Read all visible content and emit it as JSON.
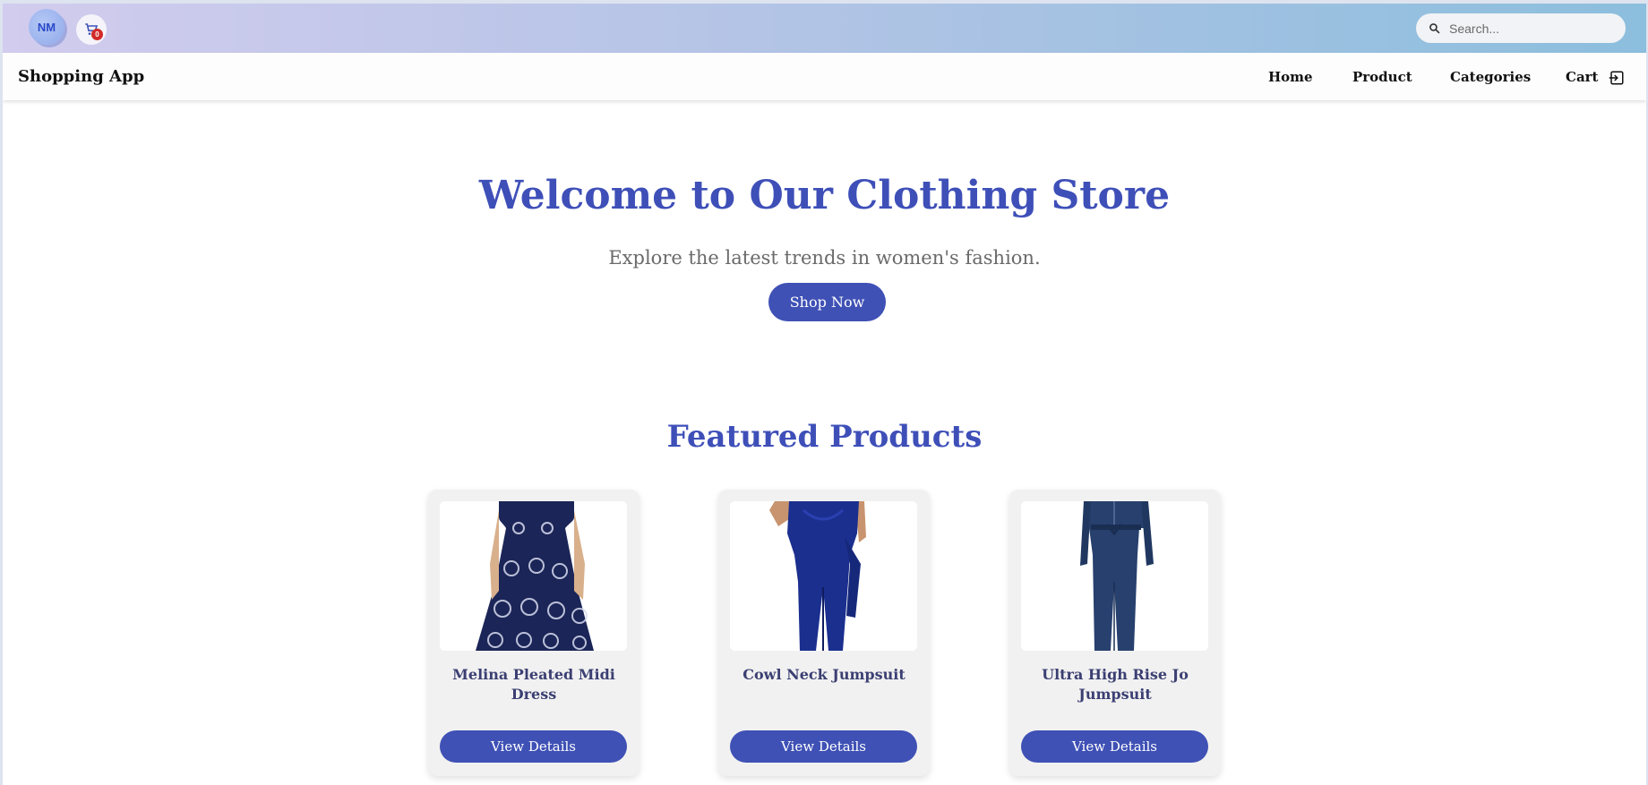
{
  "header": {
    "avatar_initials": "NM",
    "cart_count": "0",
    "search_placeholder": "Search..."
  },
  "nav": {
    "brand": "Shopping App",
    "links": [
      "Home",
      "Product",
      "Categories",
      "Cart"
    ]
  },
  "hero": {
    "title": "Welcome to Our Clothing Store",
    "subtitle": "Explore the latest trends in women's fashion.",
    "cta_label": "Shop Now"
  },
  "featured": {
    "title": "Featured Products",
    "products": [
      {
        "name": "Melina Pleated Midi Dress",
        "button_label": "View Details",
        "image_icon": "dress-image"
      },
      {
        "name": "Cowl Neck Jumpsuit",
        "button_label": "View Details",
        "image_icon": "jumpsuit-image"
      },
      {
        "name": "Ultra High Rise Jo Jumpsuit",
        "button_label": "View Details",
        "image_icon": "denim-jumpsuit-image"
      }
    ]
  },
  "colors": {
    "primary": "#3f51b5",
    "heading": "#3e4fb8",
    "badge": "#d12a2a"
  }
}
